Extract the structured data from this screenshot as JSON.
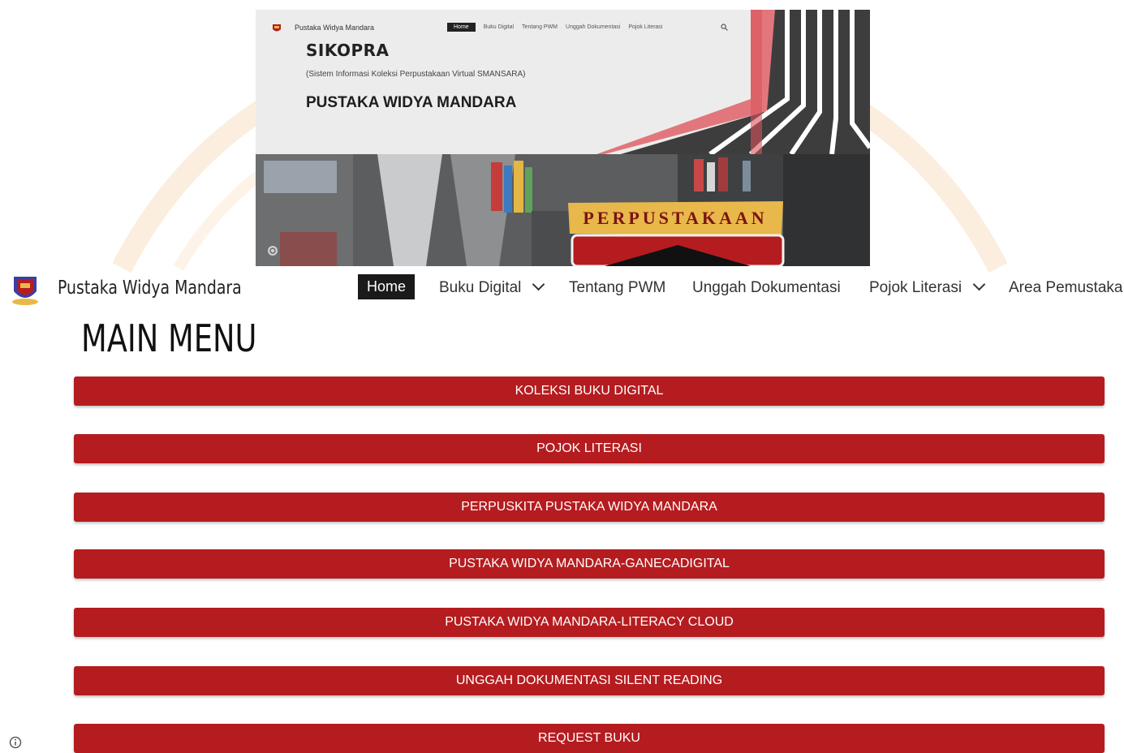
{
  "hero": {
    "site_name": "Pustaka Widya Mandara",
    "menu": [
      "Home",
      "Buku Digital",
      "Tentang PWM",
      "Unggah Dokumentasi",
      "Pojok Literasi",
      "Area Pemustaka"
    ],
    "title": "SIKOPRA",
    "subtitle": "(Sistem Informasi Koleksi Perpustakaan Virtual SMANSARA)",
    "name": "PUSTAKA WIDYA MANDARA",
    "sign_text": "PERPUSTAKAAN"
  },
  "navbar": {
    "site_title": "Pustaka Widya Mandara",
    "items": [
      {
        "label": "Home",
        "active": true
      },
      {
        "label": "Buku Digital",
        "dropdown": true
      },
      {
        "label": "Tentang PWM"
      },
      {
        "label": "Unggah Dokumentasi"
      },
      {
        "label": "Pojok Literasi",
        "dropdown": true
      },
      {
        "label": "Area Pemustaka"
      }
    ]
  },
  "main": {
    "heading": "MAIN MENU",
    "buttons": [
      "KOLEKSI BUKU DIGITAL",
      "POJOK LITERASI",
      "PERPUSKITA PUSTAKA WIDYA MANDARA",
      "PUSTAKA WIDYA MANDARA-GANECADIGITAL",
      "PUSTAKA WIDYA MANDARA-LITERACY CLOUD",
      "UNGGAH DOKUMENTASI SILENT READING",
      "REQUEST BUKU"
    ]
  },
  "colors": {
    "button_red": "#b51c1f",
    "nav_active_bg": "#1a1a1a",
    "accent_gold": "#e8b84a"
  },
  "icons": [
    "school-logo-icon",
    "search-icon",
    "camera-icon",
    "chevron-down-icon",
    "info-icon"
  ]
}
